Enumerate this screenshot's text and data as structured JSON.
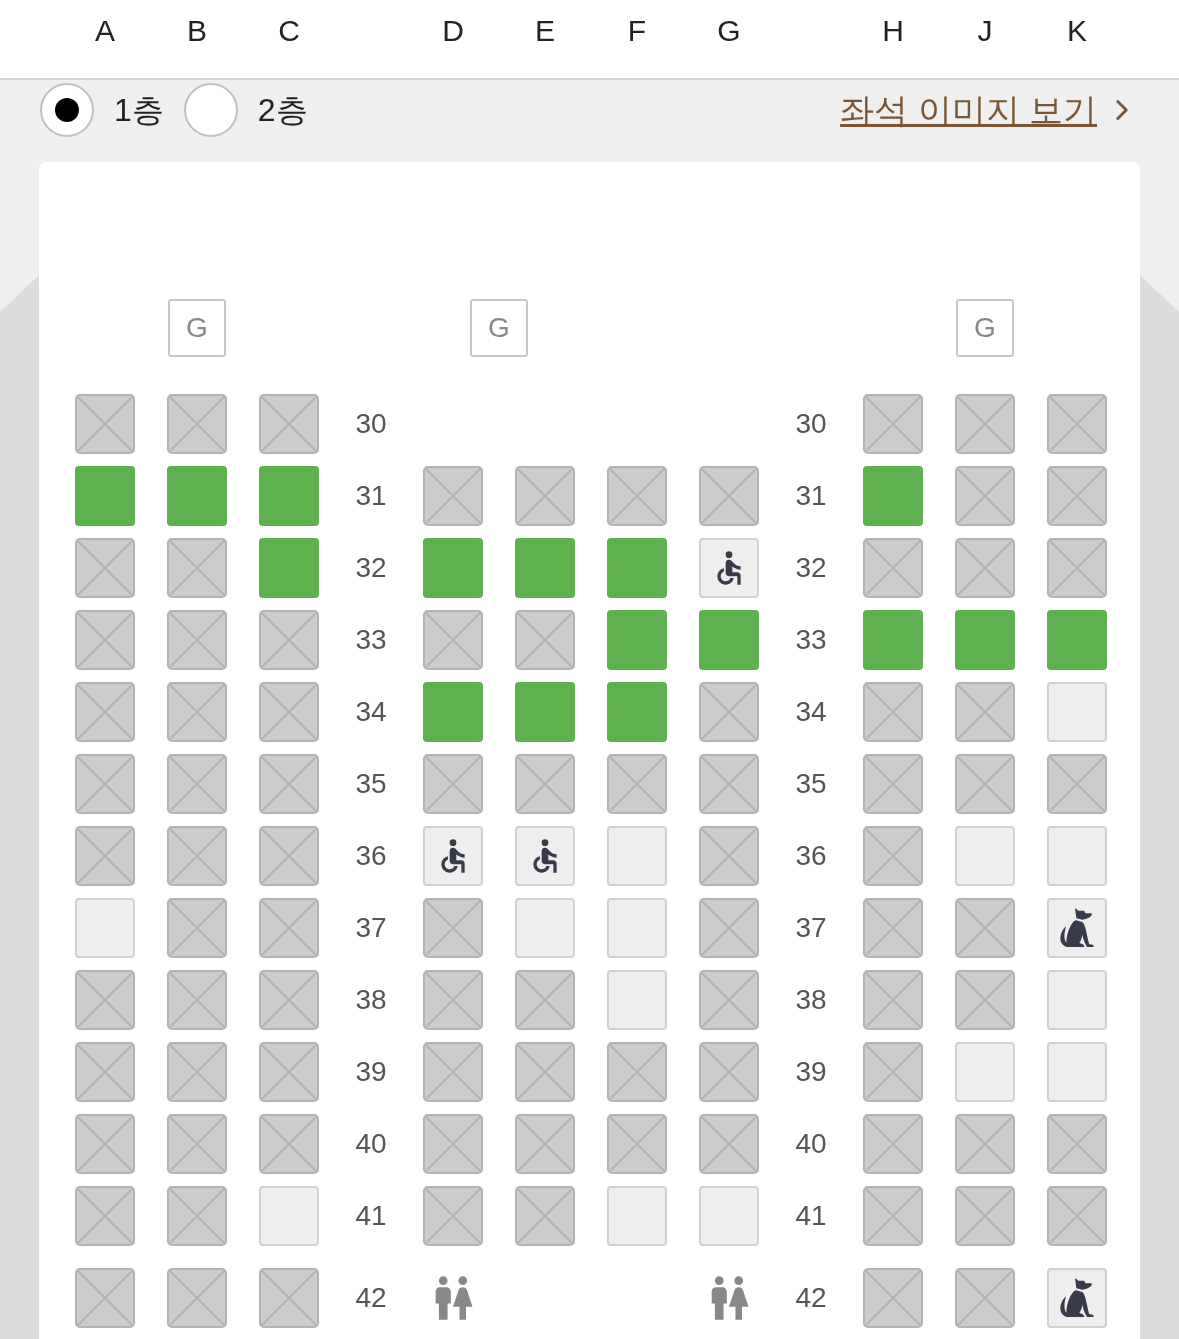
{
  "columns": [
    "A",
    "B",
    "C",
    "D",
    "E",
    "F",
    "G",
    "H",
    "J",
    "K"
  ],
  "decks": [
    {
      "label": "1층",
      "selected": true
    },
    {
      "label": "2층",
      "selected": false
    }
  ],
  "seat_image_link": "좌석 이미지 보기",
  "galleys": [
    "G",
    "G",
    "G"
  ],
  "rows": [
    {
      "left_number": "30",
      "right_number": "30",
      "seats": [
        {
          "kind": "sold"
        },
        {
          "kind": "sold"
        },
        {
          "kind": "sold"
        },
        {
          "kind": "none"
        },
        {
          "kind": "none"
        },
        {
          "kind": "none"
        },
        {
          "kind": "none"
        },
        {
          "kind": "sold"
        },
        {
          "kind": "sold"
        },
        {
          "kind": "sold"
        }
      ]
    },
    {
      "left_number": "31",
      "right_number": "31",
      "seats": [
        {
          "kind": "available"
        },
        {
          "kind": "available"
        },
        {
          "kind": "available"
        },
        {
          "kind": "sold"
        },
        {
          "kind": "sold"
        },
        {
          "kind": "sold"
        },
        {
          "kind": "sold"
        },
        {
          "kind": "available"
        },
        {
          "kind": "sold"
        },
        {
          "kind": "sold"
        }
      ]
    },
    {
      "left_number": "32",
      "right_number": "32",
      "seats": [
        {
          "kind": "sold"
        },
        {
          "kind": "sold"
        },
        {
          "kind": "available"
        },
        {
          "kind": "available"
        },
        {
          "kind": "available"
        },
        {
          "kind": "available"
        },
        {
          "kind": "wheelchair"
        },
        {
          "kind": "sold"
        },
        {
          "kind": "sold"
        },
        {
          "kind": "sold"
        }
      ]
    },
    {
      "left_number": "33",
      "right_number": "33",
      "seats": [
        {
          "kind": "sold"
        },
        {
          "kind": "sold"
        },
        {
          "kind": "sold"
        },
        {
          "kind": "sold"
        },
        {
          "kind": "sold"
        },
        {
          "kind": "available"
        },
        {
          "kind": "available"
        },
        {
          "kind": "available"
        },
        {
          "kind": "available"
        },
        {
          "kind": "available"
        }
      ]
    },
    {
      "left_number": "34",
      "right_number": "34",
      "seats": [
        {
          "kind": "sold"
        },
        {
          "kind": "sold"
        },
        {
          "kind": "sold"
        },
        {
          "kind": "available"
        },
        {
          "kind": "available"
        },
        {
          "kind": "available"
        },
        {
          "kind": "sold"
        },
        {
          "kind": "sold"
        },
        {
          "kind": "sold"
        },
        {
          "kind": "blocked"
        }
      ]
    },
    {
      "left_number": "35",
      "right_number": "35",
      "seats": [
        {
          "kind": "sold"
        },
        {
          "kind": "sold"
        },
        {
          "kind": "sold"
        },
        {
          "kind": "sold"
        },
        {
          "kind": "sold"
        },
        {
          "kind": "sold"
        },
        {
          "kind": "sold"
        },
        {
          "kind": "sold"
        },
        {
          "kind": "sold"
        },
        {
          "kind": "sold"
        }
      ]
    },
    {
      "left_number": "36",
      "right_number": "36",
      "seats": [
        {
          "kind": "sold"
        },
        {
          "kind": "sold"
        },
        {
          "kind": "sold"
        },
        {
          "kind": "wheelchair"
        },
        {
          "kind": "wheelchair"
        },
        {
          "kind": "blocked"
        },
        {
          "kind": "sold"
        },
        {
          "kind": "sold"
        },
        {
          "kind": "blocked"
        },
        {
          "kind": "blocked"
        }
      ]
    },
    {
      "left_number": "37",
      "right_number": "37",
      "seats": [
        {
          "kind": "blocked"
        },
        {
          "kind": "sold"
        },
        {
          "kind": "sold"
        },
        {
          "kind": "sold"
        },
        {
          "kind": "blocked"
        },
        {
          "kind": "blocked"
        },
        {
          "kind": "sold"
        },
        {
          "kind": "sold"
        },
        {
          "kind": "sold"
        },
        {
          "kind": "pet"
        }
      ]
    },
    {
      "left_number": "38",
      "right_number": "38",
      "seats": [
        {
          "kind": "sold"
        },
        {
          "kind": "sold"
        },
        {
          "kind": "sold"
        },
        {
          "kind": "sold"
        },
        {
          "kind": "sold"
        },
        {
          "kind": "blocked"
        },
        {
          "kind": "sold"
        },
        {
          "kind": "sold"
        },
        {
          "kind": "sold"
        },
        {
          "kind": "blocked"
        }
      ]
    },
    {
      "left_number": "39",
      "right_number": "39",
      "seats": [
        {
          "kind": "sold"
        },
        {
          "kind": "sold"
        },
        {
          "kind": "sold"
        },
        {
          "kind": "sold"
        },
        {
          "kind": "sold"
        },
        {
          "kind": "sold"
        },
        {
          "kind": "sold"
        },
        {
          "kind": "sold"
        },
        {
          "kind": "blocked"
        },
        {
          "kind": "blocked"
        }
      ]
    },
    {
      "left_number": "40",
      "right_number": "40",
      "seats": [
        {
          "kind": "sold"
        },
        {
          "kind": "sold"
        },
        {
          "kind": "sold"
        },
        {
          "kind": "sold"
        },
        {
          "kind": "sold"
        },
        {
          "kind": "sold"
        },
        {
          "kind": "sold"
        },
        {
          "kind": "sold"
        },
        {
          "kind": "sold"
        },
        {
          "kind": "sold"
        }
      ]
    },
    {
      "left_number": "41",
      "right_number": "41",
      "seats": [
        {
          "kind": "sold"
        },
        {
          "kind": "sold"
        },
        {
          "kind": "blocked"
        },
        {
          "kind": "sold"
        },
        {
          "kind": "sold"
        },
        {
          "kind": "blocked"
        },
        {
          "kind": "blocked"
        },
        {
          "kind": "sold"
        },
        {
          "kind": "sold"
        },
        {
          "kind": "sold"
        }
      ]
    },
    {
      "left_number": "42",
      "right_number": "42",
      "seats": [
        {
          "kind": "sold"
        },
        {
          "kind": "sold"
        },
        {
          "kind": "sold"
        },
        {
          "kind": "restroom"
        },
        {
          "kind": "none"
        },
        {
          "kind": "none"
        },
        {
          "kind": "restroom"
        },
        {
          "kind": "sold"
        },
        {
          "kind": "sold"
        },
        {
          "kind": "pet"
        }
      ]
    }
  ]
}
